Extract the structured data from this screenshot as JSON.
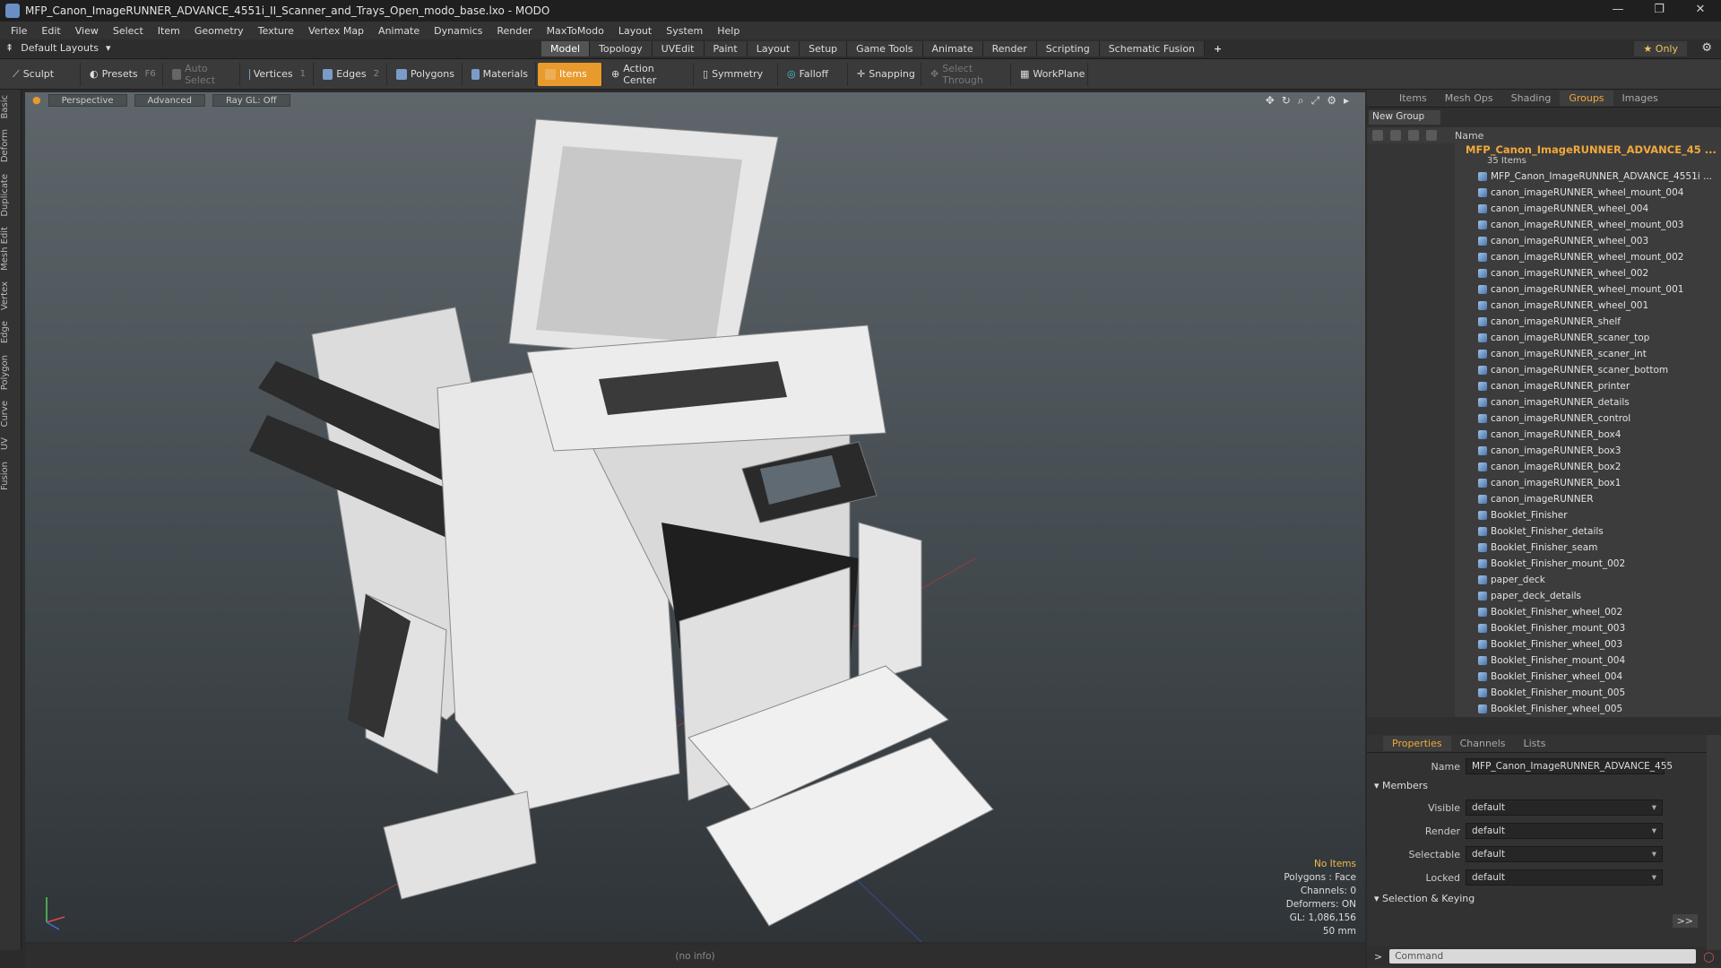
{
  "window": {
    "title": "MFP_Canon_ImageRUNNER_ADVANCE_4551i_II_Scanner_and_Trays_Open_modo_base.lxo - MODO",
    "minimize": "—",
    "maximize": "❐",
    "close": "✕"
  },
  "menu": [
    "File",
    "Edit",
    "View",
    "Select",
    "Item",
    "Geometry",
    "Texture",
    "Vertex Map",
    "Animate",
    "Dynamics",
    "Render",
    "MaxToModo",
    "Layout",
    "System",
    "Help"
  ],
  "mode_bar": {
    "layout": "Default Layouts",
    "tabs": [
      "Model",
      "Topology",
      "UVEdit",
      "Paint",
      "Layout",
      "Setup",
      "Game Tools",
      "Animate",
      "Render",
      "Scripting",
      "Schematic Fusion"
    ],
    "active_tab": "Model",
    "add": "+",
    "only": "Only"
  },
  "toolbar": {
    "sculpt": "Sculpt",
    "presets": "Presets",
    "presets_key": "F6",
    "auto_select": "Auto Select",
    "vertices": "Vertices",
    "vertices_key": "1",
    "edges": "Edges",
    "edges_key": "2",
    "polygons": "Polygons",
    "materials": "Materials",
    "items": "Items",
    "action_center": "Action Center",
    "symmetry": "Symmetry",
    "falloff": "Falloff",
    "snapping": "Snapping",
    "select_through": "Select Through",
    "workplane": "WorkPlane"
  },
  "left_tabs": [
    "Basic",
    "Deform",
    "Duplicate",
    "Mesh Edit",
    "Vertex",
    "Edge",
    "Polygon",
    "Curve",
    "UV",
    "Fusion"
  ],
  "viewport": {
    "perspective": "Perspective",
    "advanced": "Advanced",
    "raygl": "Ray GL: Off",
    "info": {
      "items": "No Items",
      "polygons": "Polygons : Face",
      "channels": "Channels: 0",
      "deformers": "Deformers: ON",
      "gl": "GL: 1,086,156",
      "scale": "50 mm"
    }
  },
  "status": "(no info)",
  "panel_tabs": [
    "Items",
    "Mesh Ops",
    "Shading",
    "Groups",
    "Images"
  ],
  "active_panel_tab": "Groups",
  "new_group": "New Group",
  "list_header": "Name",
  "group": {
    "name": "MFP_Canon_ImageRUNNER_ADVANCE_45 ...",
    "count": "35 Items"
  },
  "items": [
    "MFP_Canon_ImageRUNNER_ADVANCE_4551i ...",
    "canon_imageRUNNER_wheel_mount_004",
    "canon_imageRUNNER_wheel_004",
    "canon_imageRUNNER_wheel_mount_003",
    "canon_imageRUNNER_wheel_003",
    "canon_imageRUNNER_wheel_mount_002",
    "canon_imageRUNNER_wheel_002",
    "canon_imageRUNNER_wheel_mount_001",
    "canon_imageRUNNER_wheel_001",
    "canon_imageRUNNER_shelf",
    "canon_imageRUNNER_scaner_top",
    "canon_imageRUNNER_scaner_int",
    "canon_imageRUNNER_scaner_bottom",
    "canon_imageRUNNER_printer",
    "canon_imageRUNNER_details",
    "canon_imageRUNNER_control",
    "canon_imageRUNNER_box4",
    "canon_imageRUNNER_box3",
    "canon_imageRUNNER_box2",
    "canon_imageRUNNER_box1",
    "canon_imageRUNNER",
    "Booklet_Finisher",
    "Booklet_Finisher_details",
    "Booklet_Finisher_seam",
    "Booklet_Finisher_mount_002",
    "paper_deck",
    "paper_deck_details",
    "Booklet_Finisher_wheel_002",
    "Booklet_Finisher_mount_003",
    "Booklet_Finisher_wheel_003",
    "Booklet_Finisher_mount_004",
    "Booklet_Finisher_wheel_004",
    "Booklet_Finisher_mount_005",
    "Booklet_Finisher_wheel_005"
  ],
  "props_tabs": [
    "Properties",
    "Channels",
    "Lists"
  ],
  "active_props_tab": "Properties",
  "props": {
    "name_label": "Name",
    "name_value": "MFP_Canon_ImageRUNNER_ADVANCE_455",
    "members": "Members",
    "visible_label": "Visible",
    "visible_value": "default",
    "render_label": "Render",
    "render_value": "default",
    "selectable_label": "Selectable",
    "selectable_value": "default",
    "locked_label": "Locked",
    "locked_value": "default",
    "selection_keying": "Selection & Keying",
    "expand": ">>"
  },
  "command": "Command",
  "colors": {
    "accent": "#f2a93b",
    "items_active": "#e89a2c"
  }
}
